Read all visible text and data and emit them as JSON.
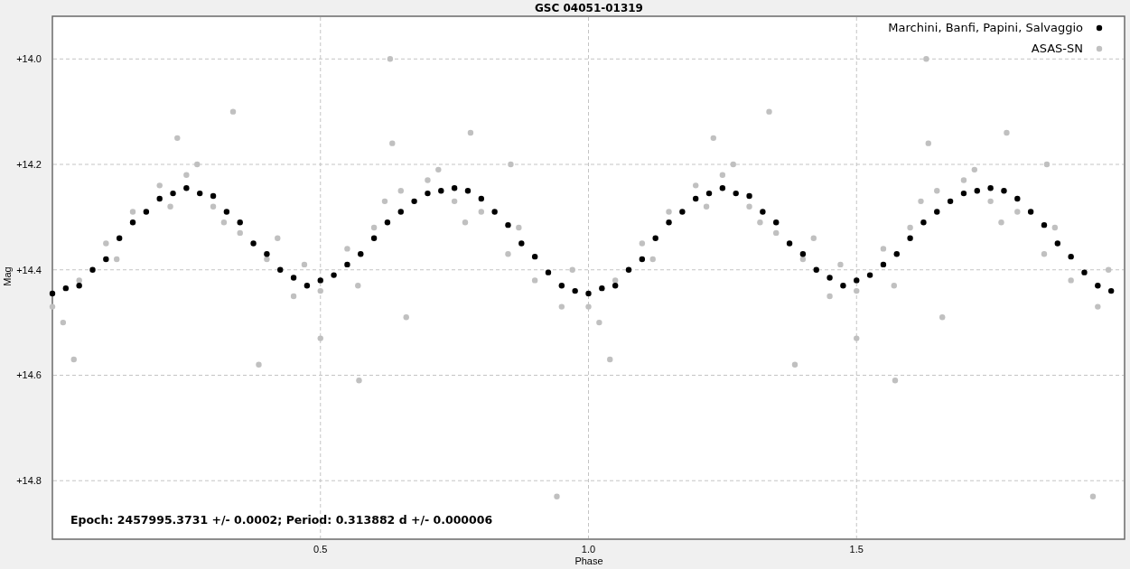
{
  "plot": {
    "chart_data": {
      "type": "scatter",
      "title": "GSC 04051-01319",
      "xlabel": "Phase",
      "ylabel": "Mag",
      "xlim": [
        0,
        2
      ],
      "ylim": [
        14.911,
        13.919
      ],
      "xticks": [
        {
          "value": 0.5,
          "label": "0.5"
        },
        {
          "value": 1,
          "label": "1.0"
        },
        {
          "value": 1.5,
          "label": "1.5"
        }
      ],
      "yticks": [
        {
          "value": 14.0,
          "label": "+14.0"
        },
        {
          "value": 14.2,
          "label": "+14.2"
        },
        {
          "value": 14.4,
          "label": "+14.4"
        },
        {
          "value": 14.6,
          "label": "+14.6"
        },
        {
          "value": 14.8,
          "label": "+14.8"
        }
      ],
      "series": [
        {
          "name": "Marchini, Banfi, Papini, Salvaggio",
          "color": "#000000",
          "x": [
            0,
            0.025,
            0.05,
            0.075,
            0.1,
            0.125,
            0.15,
            0.175,
            0.2,
            0.225,
            0.25,
            0.275,
            0.3,
            0.325,
            0.35,
            0.375,
            0.4,
            0.425,
            0.45,
            0.475,
            0.5,
            0.525,
            0.55,
            0.575,
            0.6,
            0.625,
            0.65,
            0.675,
            0.7,
            0.725,
            0.75,
            0.775,
            0.8,
            0.825,
            0.85,
            0.875,
            0.9,
            0.925,
            0.95,
            0.975,
            1,
            1.025,
            1.05,
            1.075,
            1.1,
            1.125,
            1.15,
            1.175,
            1.2,
            1.225,
            1.25,
            1.275,
            1.3,
            1.325,
            1.35,
            1.375,
            1.4,
            1.425,
            1.45,
            1.475,
            1.5,
            1.525,
            1.55,
            1.575,
            1.6,
            1.625,
            1.65,
            1.675,
            1.7,
            1.725,
            1.75,
            1.775,
            1.8,
            1.825,
            1.85,
            1.875,
            1.9,
            1.925,
            1.95,
            1.975
          ],
          "values": [
            14.445,
            14.435,
            14.43,
            14.4,
            14.38,
            14.34,
            14.31,
            14.29,
            14.265,
            14.255,
            14.245,
            14.255,
            14.26,
            14.29,
            14.31,
            14.35,
            14.37,
            14.4,
            14.415,
            14.43,
            14.42,
            14.41,
            14.39,
            14.37,
            14.34,
            14.31,
            14.29,
            14.27,
            14.255,
            14.25,
            14.245,
            14.25,
            14.265,
            14.29,
            14.315,
            14.35,
            14.375,
            14.405,
            14.43,
            14.44,
            14.445,
            14.435,
            14.43,
            14.4,
            14.38,
            14.34,
            14.31,
            14.29,
            14.265,
            14.255,
            14.245,
            14.255,
            14.26,
            14.29,
            14.31,
            14.35,
            14.37,
            14.4,
            14.415,
            14.43,
            14.42,
            14.41,
            14.39,
            14.37,
            14.34,
            14.31,
            14.29,
            14.27,
            14.255,
            14.25,
            14.245,
            14.25,
            14.265,
            14.29,
            14.315,
            14.35,
            14.375,
            14.405,
            14.43,
            14.44
          ]
        },
        {
          "name": "ASAS-SN",
          "color": "#c0c0c0",
          "x": [
            0,
            0.05,
            0.1,
            0.15,
            0.2,
            0.25,
            0.3,
            0.35,
            0.4,
            0.45,
            0.5,
            0.55,
            0.6,
            0.65,
            0.7,
            0.75,
            0.8,
            0.85,
            0.9,
            0.95,
            0.02,
            0.12,
            0.22,
            0.27,
            0.32,
            0.42,
            0.47,
            0.57,
            0.62,
            0.72,
            0.77,
            0.87,
            0.97,
            0.04,
            0.233,
            0.337,
            0.385,
            0.572,
            0.63,
            0.634,
            0.78,
            0.941,
            0.855,
            0.5,
            0.66,
            1,
            1.05,
            1.1,
            1.15,
            1.2,
            1.25,
            1.3,
            1.35,
            1.4,
            1.45,
            1.5,
            1.55,
            1.6,
            1.65,
            1.7,
            1.75,
            1.8,
            1.85,
            1.9,
            1.95,
            1.02,
            1.12,
            1.22,
            1.27,
            1.32,
            1.42,
            1.47,
            1.57,
            1.62,
            1.72,
            1.77,
            1.87,
            1.97,
            1.04,
            1.233,
            1.337,
            1.385,
            1.572,
            1.63,
            1.634,
            1.78,
            1.941,
            1.855,
            1.5,
            1.66
          ],
          "values": [
            14.47,
            14.42,
            14.35,
            14.29,
            14.24,
            14.22,
            14.28,
            14.33,
            14.38,
            14.45,
            14.44,
            14.36,
            14.32,
            14.25,
            14.23,
            14.27,
            14.29,
            14.37,
            14.42,
            14.47,
            14.5,
            14.38,
            14.28,
            14.2,
            14.31,
            14.34,
            14.39,
            14.43,
            14.27,
            14.21,
            14.31,
            14.32,
            14.4,
            14.57,
            14.15,
            14.1,
            14.58,
            14.61,
            14.0,
            14.16,
            14.14,
            14.83,
            14.2,
            14.53,
            14.49,
            14.47,
            14.42,
            14.35,
            14.29,
            14.24,
            14.22,
            14.28,
            14.33,
            14.38,
            14.45,
            14.44,
            14.36,
            14.32,
            14.25,
            14.23,
            14.27,
            14.29,
            14.37,
            14.42,
            14.47,
            14.5,
            14.38,
            14.28,
            14.2,
            14.31,
            14.34,
            14.39,
            14.43,
            14.27,
            14.21,
            14.31,
            14.32,
            14.4,
            14.57,
            14.15,
            14.1,
            14.58,
            14.61,
            14.0,
            14.16,
            14.14,
            14.83,
            14.2,
            14.53,
            14.49
          ]
        }
      ],
      "grid": true,
      "legend": true,
      "annotations": [
        "Epoch: 2457995.3731 +/- 0.0002; Period: 0.313882 d +/- 0.000006"
      ]
    }
  }
}
